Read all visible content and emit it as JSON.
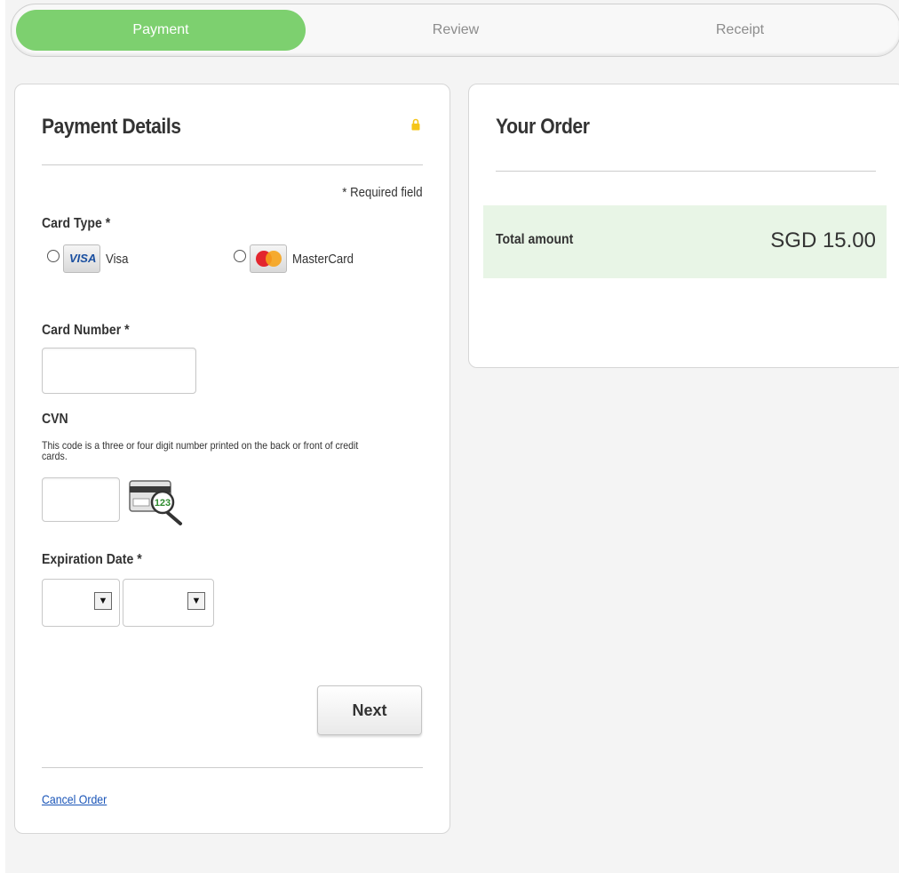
{
  "steps": {
    "payment": "Payment",
    "review": "Review",
    "receipt": "Receipt"
  },
  "payment_details": {
    "title": "Payment Details",
    "required_note": "* Required field",
    "card_type_label": "Card Type *",
    "card_options": [
      {
        "label": "Visa",
        "logo_text": "VISA"
      },
      {
        "label": "MasterCard",
        "logo_text": "MasterCard"
      }
    ],
    "card_number_label": "Card Number *",
    "card_number_value": "",
    "cvn_label": "CVN",
    "cvn_help": "This code is a three or four digit number printed on the back or front of credit cards.",
    "cvn_value": "",
    "cvn_icon_text": "123",
    "expiration_label": "Expiration Date *",
    "expiration_month": "",
    "expiration_year": "",
    "next_label": "Next",
    "cancel_label": "Cancel Order"
  },
  "order": {
    "title": "Your Order",
    "total_label": "Total amount",
    "total_value": "SGD 15.00"
  },
  "colors": {
    "active_step": "#7dd06f",
    "total_band": "#e8f5e6",
    "link": "#1a55b8",
    "lock": "#f5c518"
  }
}
